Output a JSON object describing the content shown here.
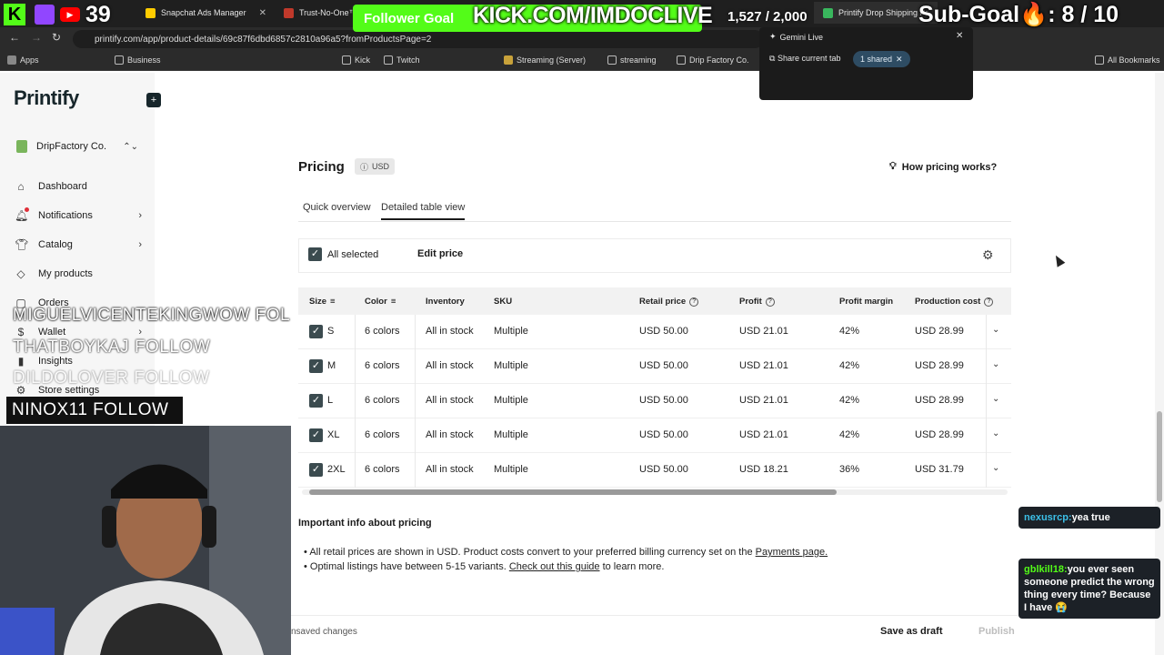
{
  "browser": {
    "tabs": [
      {
        "label": "Snapchat Ads Manager",
        "color": "#ffcc00"
      },
      {
        "label": "Trust-No-One™",
        "color": "#c0392b"
      },
      {
        "label": "Printify Drop Shipping Pr",
        "color": "#39b75d"
      }
    ],
    "url": "printify.com/app/product-details/69c87f6dbd6857c2810a96a5?fromProductsPage=2",
    "bookmarks": [
      {
        "label": "Apps"
      },
      {
        "label": "Business"
      },
      {
        "label": "Kick"
      },
      {
        "label": "Twitch"
      },
      {
        "label": "Streaming (Server)"
      },
      {
        "label": "streaming"
      },
      {
        "label": "Drip Factory Co."
      },
      {
        "label": "All Bookmarks"
      }
    ]
  },
  "gemini": {
    "title": "Gemini Live",
    "share_label": "Share current tab",
    "shared_label": "1 shared"
  },
  "sidebar": {
    "logo": "Printify",
    "store": "DripFactory Co.",
    "items": [
      {
        "label": "Dashboard",
        "icon": "home-icon"
      },
      {
        "label": "Notifications",
        "icon": "bell-icon"
      },
      {
        "label": "Catalog",
        "icon": "shirt-icon"
      },
      {
        "label": "My products",
        "icon": "tag-icon"
      },
      {
        "label": "Orders",
        "icon": "box-icon"
      },
      {
        "label": "Wallet",
        "icon": "dollar-icon"
      },
      {
        "label": "Insights",
        "icon": "chart-icon"
      },
      {
        "label": "Store settings",
        "icon": "gear-icon"
      }
    ]
  },
  "pricing": {
    "title": "Pricing",
    "currency": "USD",
    "how_link": "How pricing works?",
    "tabs": [
      {
        "label": "Quick overview",
        "active": false
      },
      {
        "label": "Detailed table view",
        "active": true
      }
    ],
    "all_selected": "All selected",
    "edit_price": "Edit price",
    "columns": [
      "Size",
      "Color",
      "Inventory",
      "SKU",
      "Retail price",
      "Profit",
      "Profit margin",
      "Production cost"
    ],
    "rows": [
      {
        "size": "S",
        "color": "6 colors",
        "inventory": "All in stock",
        "sku": "Multiple",
        "retail": "USD 50.00",
        "profit": "USD 21.01",
        "margin": "42%",
        "cost": "USD 28.99"
      },
      {
        "size": "M",
        "color": "6 colors",
        "inventory": "All in stock",
        "sku": "Multiple",
        "retail": "USD 50.00",
        "profit": "USD 21.01",
        "margin": "42%",
        "cost": "USD 28.99"
      },
      {
        "size": "L",
        "color": "6 colors",
        "inventory": "All in stock",
        "sku": "Multiple",
        "retail": "USD 50.00",
        "profit": "USD 21.01",
        "margin": "42%",
        "cost": "USD 28.99"
      },
      {
        "size": "XL",
        "color": "6 colors",
        "inventory": "All in stock",
        "sku": "Multiple",
        "retail": "USD 50.00",
        "profit": "USD 21.01",
        "margin": "42%",
        "cost": "USD 28.99"
      },
      {
        "size": "2XL",
        "color": "6 colors",
        "inventory": "All in stock",
        "sku": "Multiple",
        "retail": "USD 50.00",
        "profit": "USD 18.21",
        "margin": "36%",
        "cost": "USD 31.79"
      }
    ],
    "info_title": "Important info about pricing",
    "bullet1_text": "All retail prices are shown in USD. Product costs convert to your preferred billing currency set on the",
    "bullet1_link": "Payments page.",
    "bullet2_text": "Optimal listings have between 5-15 variants.",
    "bullet2_link": "Check out this guide",
    "bullet2_tail": "to learn more."
  },
  "footer": {
    "unsaved": "nsaved changes",
    "save_draft": "Save as draft",
    "publish": "Publish"
  },
  "overlay": {
    "viewers": "39",
    "follower_goal": "Follower Goal",
    "kick_url": "KICK.COM/IMDOCLIVE",
    "follower_count": "1,527 / 2,000",
    "sub_goal": "Sub-Goal🔥: 8 / 10",
    "follows": [
      {
        "text": "MIGUELVICENTEKINGWOW  FOL"
      },
      {
        "text": "THATBOYKAJ  FOLLOW"
      },
      {
        "text": "DILDOLOVER  FOLLOW"
      }
    ],
    "follow_box": "NINOX11  FOLLOW",
    "chat": [
      {
        "user": "nexusrcp:",
        "msg": "yea true"
      },
      {
        "user": "gblkill18:",
        "msg": "you ever seen someone predict the wrong thing every time? Because I have 😭"
      }
    ]
  },
  "colors": {
    "kick_green": "#53fc18",
    "accent_dark": "#17262b",
    "checkbox": "#3b4b4f"
  }
}
